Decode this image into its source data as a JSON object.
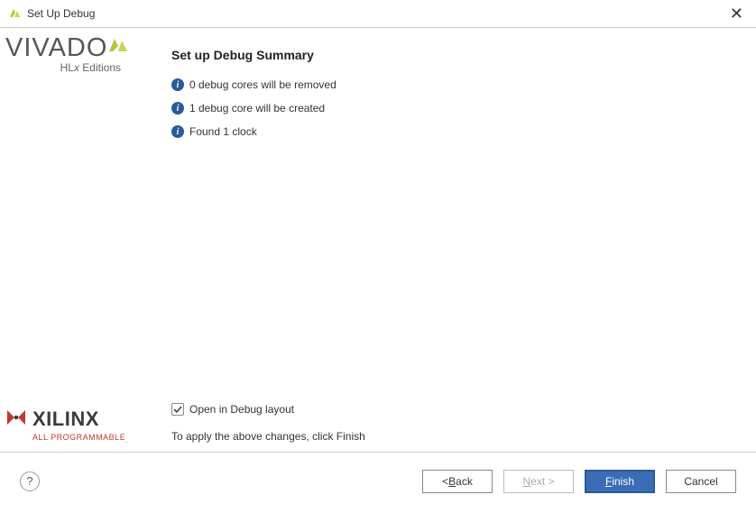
{
  "titlebar": {
    "title": "Set Up Debug",
    "close_glyph": "✕"
  },
  "branding": {
    "vivado": "VIVADO",
    "hlx_prefix": "HL",
    "hlx_italic": "x",
    "hlx_suffix": " Editions",
    "xilinx": "XILINX",
    "tagline_prefix": "ALL PROGRAMMABLE",
    "tagline_suffix": "."
  },
  "content": {
    "heading": "Set up Debug Summary",
    "info_items": [
      {
        "text": "0 debug cores will be removed"
      },
      {
        "text": "1 debug core will be created"
      },
      {
        "text": "Found 1 clock"
      }
    ],
    "checkbox": {
      "label": "Open in Debug layout",
      "checked": true
    },
    "apply_text": "To apply the above changes, click Finish"
  },
  "footer": {
    "help_glyph": "?",
    "buttons": {
      "back_prefix": "< ",
      "back_u": "B",
      "back_rest": "ack",
      "next_u": "N",
      "next_rest": "ext >",
      "finish_u": "F",
      "finish_rest": "inish",
      "cancel": "Cancel"
    }
  }
}
